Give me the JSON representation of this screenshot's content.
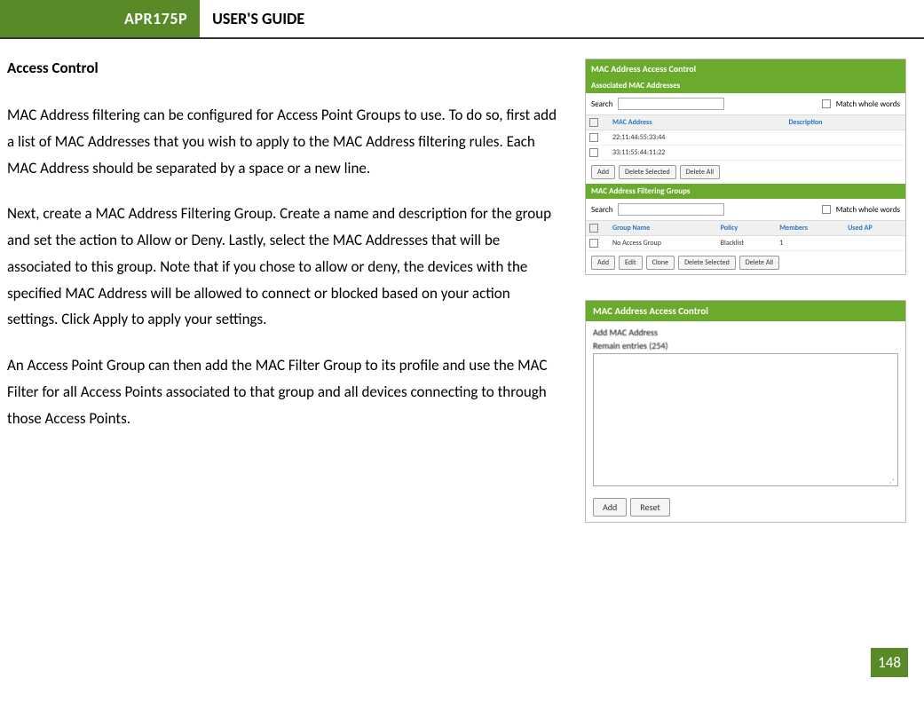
{
  "header": {
    "product": "APR175P",
    "title": "USER'S GUIDE"
  },
  "section": {
    "title": "Access Control"
  },
  "paragraphs": {
    "p1": "MAC Address filtering can be configured for Access Point Groups to use.  To do so, first add a list of MAC Addresses that you wish to apply to the MAC Address filtering rules. Each MAC Address should be separated by a space or a new line.",
    "p2": "Next, create a MAC Address Filtering Group. Create a name and description for the group and set the action to Allow or Deny. Lastly, select the MAC Addresses that will be associated to this group. Note that if you chose to allow or deny, the devices with the specified MAC Address will be allowed to connect or blocked based on your action settings. Click Apply to apply your settings.",
    "p3": "An Access Point Group can then add the MAC Filter Group to its profile and use the MAC Filter for all Access Points associated to that group and all devices connecting to through those Access Points."
  },
  "panel1": {
    "title": "MAC Address Access Control",
    "assoc_title": "Associated MAC Addresses",
    "search_label": "Search",
    "match_label": "Match whole words",
    "cols_assoc": {
      "mac": "MAC Address",
      "desc": "Description"
    },
    "rows_assoc": [
      {
        "mac": "22:11:44:55:33:44",
        "desc": ""
      },
      {
        "mac": "33:11:55:44:11:22",
        "desc": ""
      }
    ],
    "buttons_assoc": {
      "add": "Add",
      "delsel": "Delete Selected",
      "delall": "Delete All"
    },
    "groups_title": "MAC Address Filtering Groups",
    "cols_groups": {
      "name": "Group Name",
      "policy": "Policy",
      "members": "Members",
      "usedap": "Used AP"
    },
    "rows_groups": [
      {
        "name": "No Access Group",
        "policy": "Blacklist",
        "members": "1",
        "usedap": ""
      }
    ],
    "buttons_groups": {
      "add": "Add",
      "edit": "Edit",
      "clone": "Clone",
      "delsel": "Delete Selected",
      "delall": "Delete All"
    }
  },
  "panel2": {
    "title": "MAC Address Access Control",
    "label_add": "Add MAC Address",
    "label_remain": "Remain entries (254)",
    "buttons": {
      "add": "Add",
      "reset": "Reset"
    }
  },
  "page_number": "148"
}
